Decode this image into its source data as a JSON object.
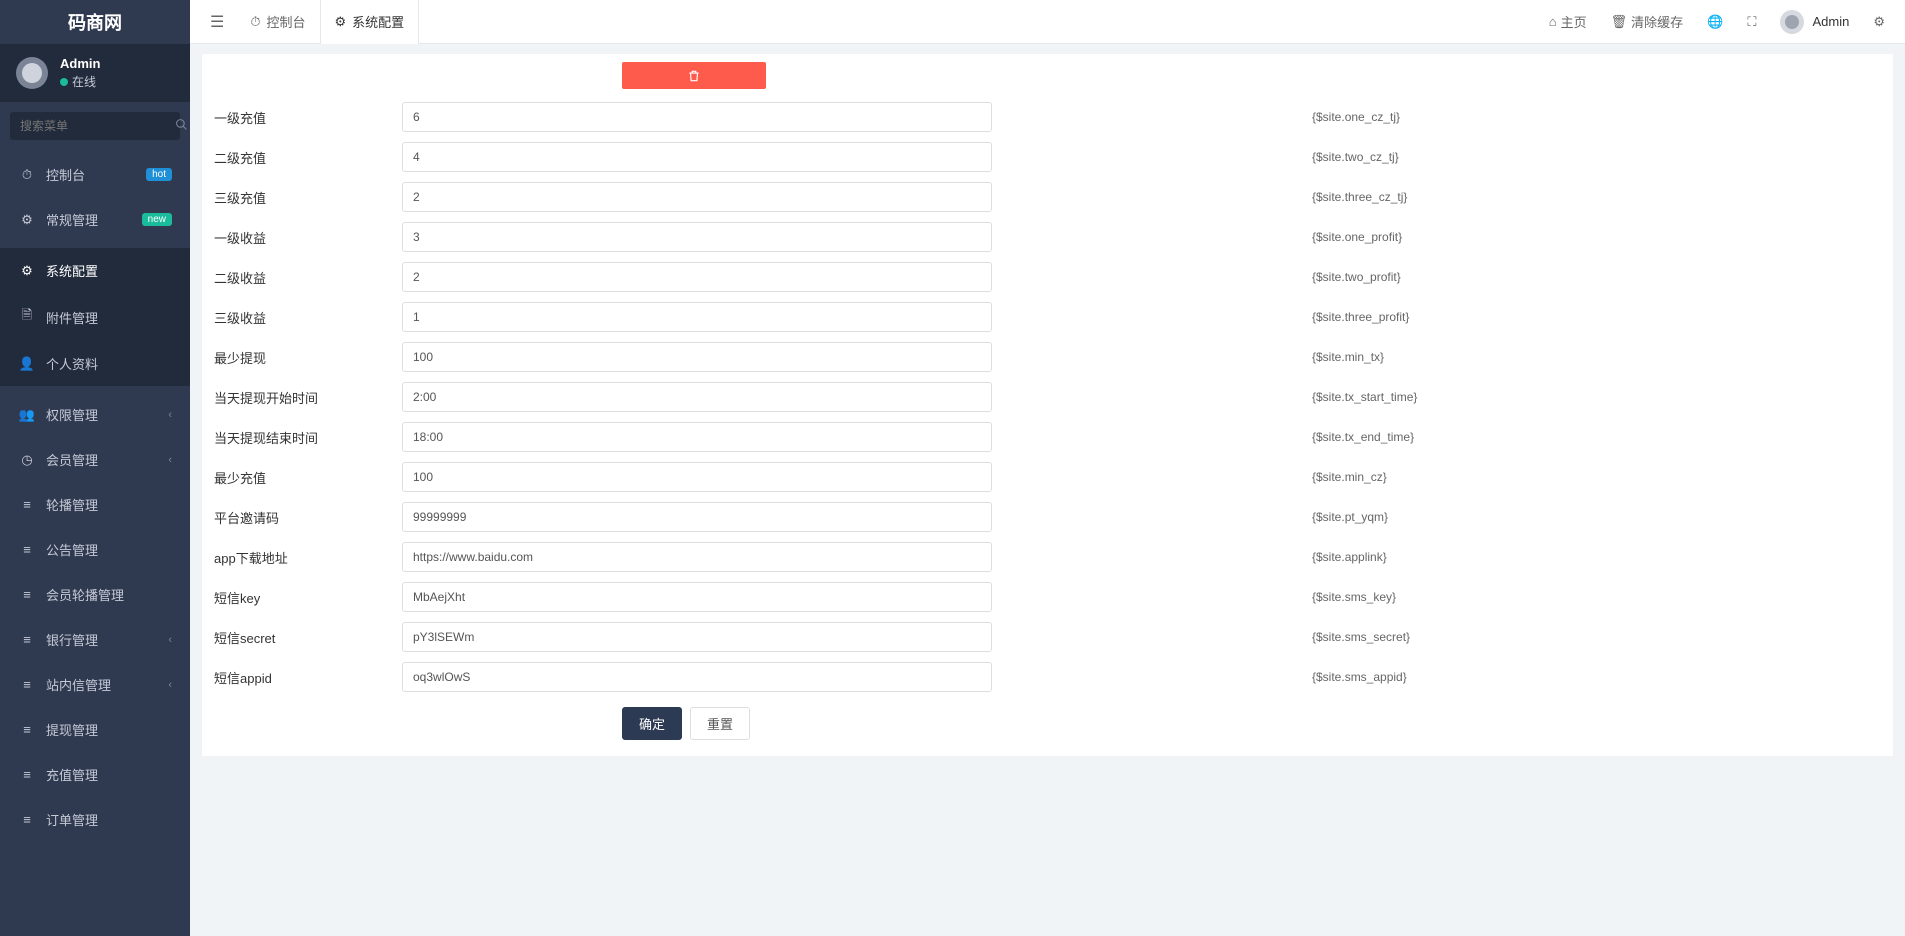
{
  "brand": "码商网",
  "user": {
    "name": "Admin",
    "status": "在线"
  },
  "search_placeholder": "搜索菜单",
  "sidebar": {
    "items": [
      {
        "icon": "⏱",
        "label": "控制台",
        "badge": "hot",
        "badge_class": "badge-hot"
      },
      {
        "icon": "⚙",
        "label": "常规管理",
        "badge": "new",
        "badge_class": "badge-new"
      }
    ],
    "sub_items": [
      {
        "icon": "⚙",
        "label": "系统配置",
        "active": true
      },
      {
        "icon": "🗎",
        "label": "附件管理"
      },
      {
        "icon": "👤",
        "label": "个人资料"
      }
    ],
    "rest": [
      {
        "icon": "👥",
        "label": "权限管理",
        "chev": true
      },
      {
        "icon": "◷",
        "label": "会员管理",
        "chev": true
      },
      {
        "icon": "≡",
        "label": "轮播管理"
      },
      {
        "icon": "≡",
        "label": "公告管理"
      },
      {
        "icon": "≡",
        "label": "会员轮播管理"
      },
      {
        "icon": "≡",
        "label": "银行管理",
        "chev": true
      },
      {
        "icon": "≡",
        "label": "站内信管理",
        "chev": true
      },
      {
        "icon": "≡",
        "label": "提现管理"
      },
      {
        "icon": "≡",
        "label": "充值管理"
      },
      {
        "icon": "≡",
        "label": "订单管理"
      }
    ]
  },
  "top": {
    "tabs": [
      {
        "icon": "⏱",
        "label": "控制台"
      },
      {
        "icon": "⚙",
        "label": "系统配置"
      }
    ],
    "home": "主页",
    "clear_cache": "清除缓存",
    "user": "Admin"
  },
  "form": {
    "rows": [
      {
        "label": "一级充值",
        "value": "6",
        "hint": "{$site.one_cz_tj}"
      },
      {
        "label": "二级充值",
        "value": "4",
        "hint": "{$site.two_cz_tj}"
      },
      {
        "label": "三级充值",
        "value": "2",
        "hint": "{$site.three_cz_tj}"
      },
      {
        "label": "一级收益",
        "value": "3",
        "hint": "{$site.one_profit}"
      },
      {
        "label": "二级收益",
        "value": "2",
        "hint": "{$site.two_profit}"
      },
      {
        "label": "三级收益",
        "value": "1",
        "hint": "{$site.three_profit}"
      },
      {
        "label": "最少提现",
        "value": "100",
        "hint": "{$site.min_tx}"
      },
      {
        "label": "当天提现开始时间",
        "value": "2:00",
        "hint": "{$site.tx_start_time}"
      },
      {
        "label": "当天提现结束时间",
        "value": "18:00",
        "hint": "{$site.tx_end_time}"
      },
      {
        "label": "最少充值",
        "value": "100",
        "hint": "{$site.min_cz}"
      },
      {
        "label": "平台邀请码",
        "value": "99999999",
        "hint": "{$site.pt_yqm}"
      },
      {
        "label": "app下载地址",
        "value": "https://www.baidu.com",
        "hint": "{$site.applink}"
      },
      {
        "label": "短信key",
        "value": "MbAejXht",
        "hint": "{$site.sms_key}"
      },
      {
        "label": "短信secret",
        "value": "pY3lSEWm",
        "hint": "{$site.sms_secret}"
      },
      {
        "label": "短信appid",
        "value": "oq3wlOwS",
        "hint": "{$site.sms_appid}"
      }
    ],
    "submit": "确定",
    "reset": "重置"
  }
}
